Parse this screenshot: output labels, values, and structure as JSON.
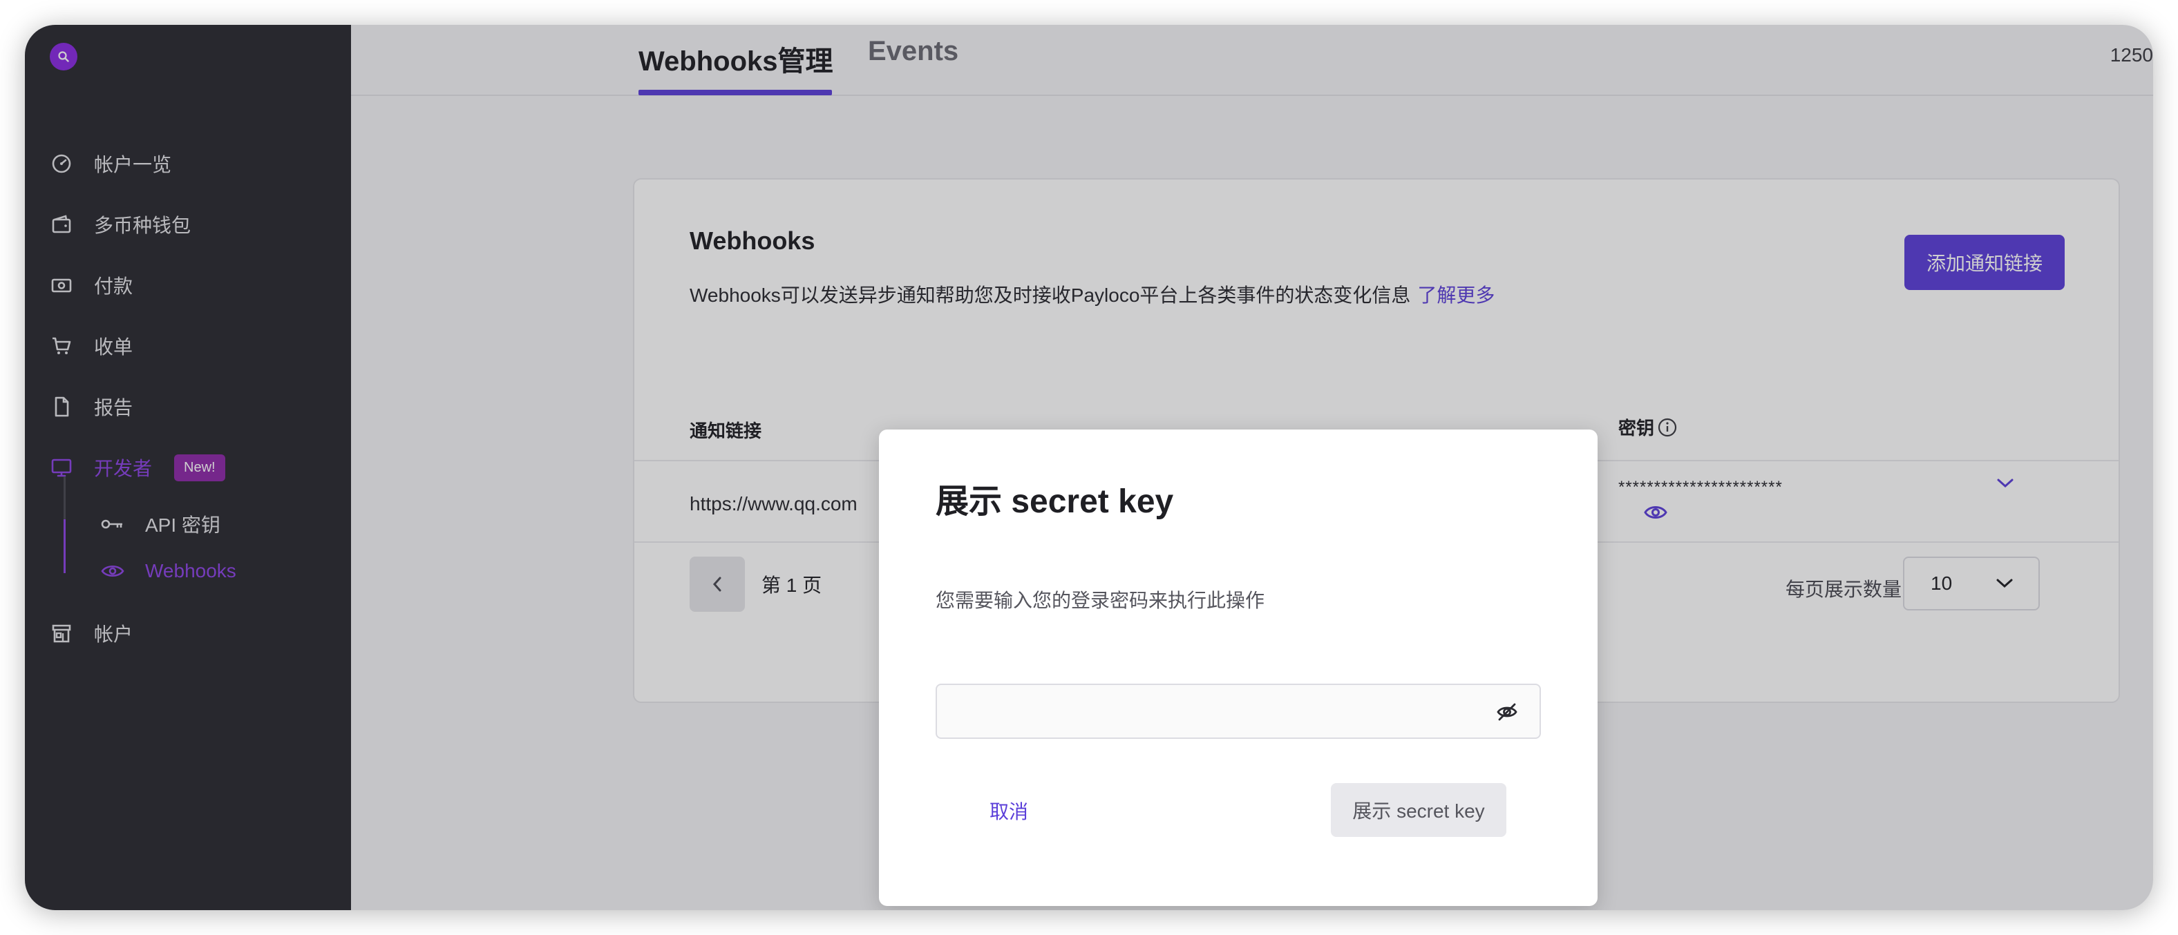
{
  "sidebar": {
    "items": [
      {
        "label": "帐户一览",
        "icon": "gauge-icon"
      },
      {
        "label": "多币种钱包",
        "icon": "wallet-icon"
      },
      {
        "label": "付款",
        "icon": "money-icon"
      },
      {
        "label": "收单",
        "icon": "cart-icon"
      },
      {
        "label": "报告",
        "icon": "document-icon"
      },
      {
        "label": "开发者",
        "icon": "monitor-icon",
        "badge": "New!"
      },
      {
        "label": "帐户",
        "icon": "store-icon"
      }
    ],
    "sub_items": [
      {
        "label": "API 密钥",
        "icon": "key-icon"
      },
      {
        "label": "Webhooks",
        "icon": "eye-icon"
      }
    ],
    "accent": "#8e44e6"
  },
  "header": {
    "tabs": [
      {
        "label": "Webhooks管理"
      },
      {
        "label": "Events"
      }
    ],
    "right_text": "1250"
  },
  "card": {
    "title": "Webhooks",
    "description": "Webhooks可以发送异步通知帮助您及时接收Payloco平台上各类事件的状态变化信息",
    "learn_more": "了解更多",
    "add_button": "添加通知链接",
    "table": {
      "columns": [
        "通知链接",
        "密钥"
      ],
      "rows": [
        {
          "url": "https://www.qq.com",
          "secret": "***********************"
        }
      ]
    },
    "pagination": {
      "page_label": "第 1 页",
      "per_page_label": "每页展示数量",
      "per_page_value": "10"
    }
  },
  "modal": {
    "title": "展示 secret key",
    "description": "您需要输入您的登录密码来执行此操作",
    "password_value": "",
    "cancel_label": "取消",
    "confirm_label": "展示 secret key"
  },
  "colors": {
    "primary": "#5b3fd9",
    "sidebar_bg": "#2b2b31"
  }
}
